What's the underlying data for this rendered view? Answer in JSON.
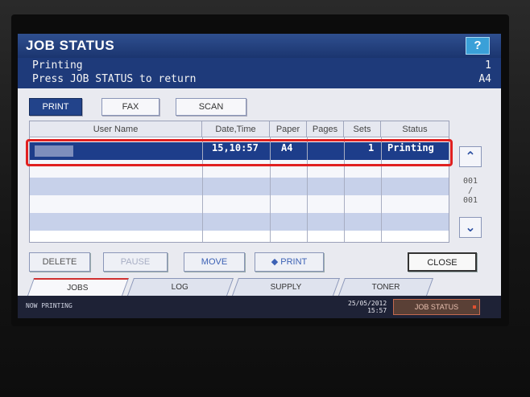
{
  "header": {
    "title": "JOB STATUS",
    "help_label": "?",
    "status_line1": "Printing",
    "status_line2": "Press JOB STATUS to return",
    "right_line1": "1",
    "right_line2": "A4"
  },
  "modes": {
    "items": [
      {
        "label": "PRINT",
        "active": true
      },
      {
        "label": "FAX",
        "active": false
      },
      {
        "label": "SCAN",
        "active": false
      }
    ]
  },
  "table": {
    "columns": [
      "User Name",
      "Date,Time",
      "Paper",
      "Pages",
      "Sets",
      "Status"
    ],
    "rows": [
      {
        "user": "",
        "datetime": "15,10:57",
        "paper": "A4",
        "pages": "",
        "sets": "1",
        "status": "Printing"
      }
    ]
  },
  "scroll": {
    "up_icon": "chevron-up-icon",
    "down_icon": "chevron-down-icon",
    "page_current": "001",
    "page_total": "001"
  },
  "actions": {
    "delete": "DELETE",
    "pause": "PAUSE",
    "move": "MOVE",
    "print": "PRINT",
    "close": "CLOSE"
  },
  "tabs": [
    {
      "label": "JOBS",
      "active": true
    },
    {
      "label": "LOG",
      "active": false
    },
    {
      "label": "SUPPLY",
      "active": false
    },
    {
      "label": "TONER",
      "active": false
    }
  ],
  "status_bar": {
    "message": "NOW PRINTING",
    "date": "25/05/2012",
    "time": "15:57",
    "job_status_label": "JOB STATUS"
  },
  "colors": {
    "header_blue": "#1e3a7a",
    "selected_row": "#1d3d8a",
    "highlight": "#e02020"
  }
}
